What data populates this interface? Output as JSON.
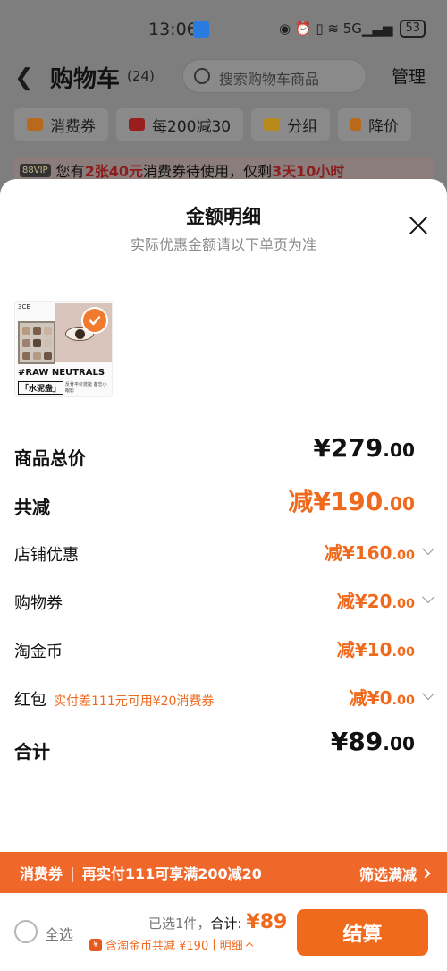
{
  "status": {
    "time": "13:06",
    "battery": "53",
    "icons": "◉ ⏰ ▯ ≋ 5G▁▃▅"
  },
  "header": {
    "title": "购物车",
    "count": "(24)",
    "search_placeholder": "搜索购物车商品",
    "manage_label": "管理"
  },
  "chips": [
    {
      "label": "消费券",
      "icon": "coupon-icon",
      "color": "#b86a1a"
    },
    {
      "label": "每200减30",
      "icon": "ticket-icon",
      "color": "#9b1e1e"
    },
    {
      "label": "分组",
      "icon": "folder-icon",
      "color": "#b8881a"
    },
    {
      "label": "降价",
      "icon": "down-arrow-icon",
      "color": "#b86a1a"
    }
  ],
  "banner": {
    "vip": "88VIP",
    "pre": "您有",
    "hl1": "2张40元",
    "mid": "消费券待使用，仅剩",
    "hl2": "3天10小时"
  },
  "sheet": {
    "title": "金额明细",
    "subtitle": "实际优惠金额请以下单页为准",
    "product": {
      "line1": "#RAW NEUTRALS",
      "line2": "「水泥盘」",
      "line3": "反骨平价技能 备忘小眼影"
    },
    "rows": [
      {
        "label": "商品总价",
        "value": "¥279",
        "dec": ".00"
      },
      {
        "label": "共减",
        "value": "减¥190",
        "dec": ".00"
      },
      {
        "label": "店铺优惠",
        "value": "减¥160",
        "dec": ".00"
      },
      {
        "label": "购物券",
        "value": "减¥20",
        "dec": ".00"
      },
      {
        "label": "淘金币",
        "value": "减¥10",
        "dec": ".00"
      },
      {
        "label": "红包",
        "note": "实付差111元可用¥20消费券",
        "value": "减¥0",
        "dec": ".00"
      },
      {
        "label": "合计",
        "value": "¥89",
        "dec": ".00"
      }
    ]
  },
  "promo": {
    "tag": "消费券",
    "sep": "|",
    "text": "再实付111可享满200减20",
    "action": "筛选满减"
  },
  "bottom": {
    "select_all": "全选",
    "selected": "已选1件，",
    "total_label": "合计:",
    "total": "¥89",
    "discount_note": "含淘金币共减 ¥190",
    "detail_sep": "|",
    "detail": "明细",
    "checkout": "结算"
  },
  "colors": {
    "accent": "#f06a1e"
  }
}
